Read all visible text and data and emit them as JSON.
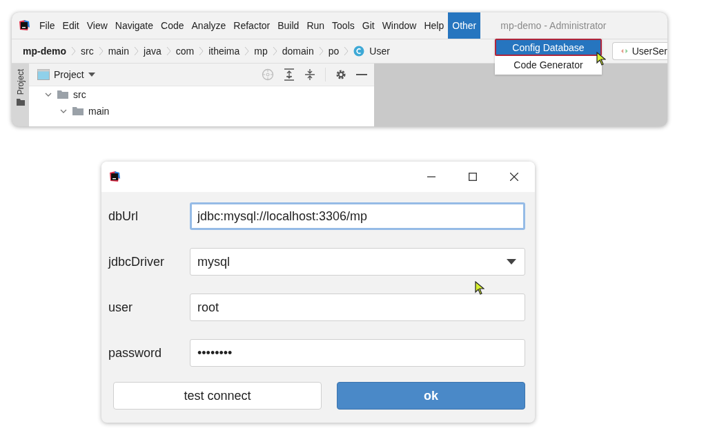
{
  "ide": {
    "menu": [
      {
        "label": "File",
        "selected": false
      },
      {
        "label": "Edit",
        "selected": false
      },
      {
        "label": "View",
        "selected": false
      },
      {
        "label": "Navigate",
        "selected": false
      },
      {
        "label": "Code",
        "selected": false
      },
      {
        "label": "Analyze",
        "selected": false
      },
      {
        "label": "Refactor",
        "selected": false
      },
      {
        "label": "Build",
        "selected": false
      },
      {
        "label": "Run",
        "selected": false
      },
      {
        "label": "Tools",
        "selected": false
      },
      {
        "label": "Git",
        "selected": false
      },
      {
        "label": "Window",
        "selected": false
      },
      {
        "label": "Help",
        "selected": false
      },
      {
        "label": "Other",
        "selected": true
      }
    ],
    "window_title": "mp-demo - Administrator",
    "breadcrumbs": [
      "mp-demo",
      "src",
      "main",
      "java",
      "com",
      "itheima",
      "mp",
      "domain",
      "po",
      "User"
    ],
    "editor_tab": "UserSer",
    "tool_window_stripe": "Project",
    "project_panel": {
      "title": "Project",
      "tree": [
        {
          "label": "src",
          "expanded": true,
          "children": [
            {
              "label": "main",
              "expanded": true
            }
          ]
        }
      ]
    },
    "dropdown": [
      {
        "label": "Config Database",
        "selected": true
      },
      {
        "label": "Code Generator",
        "selected": false
      }
    ]
  },
  "dialog": {
    "fields": [
      {
        "kind": "text",
        "label": "dbUrl",
        "value": "jdbc:mysql://localhost:3306/mp",
        "focused": true
      },
      {
        "kind": "select",
        "label": "jdbcDriver",
        "value": "mysql",
        "focused": false
      },
      {
        "kind": "text",
        "label": "user",
        "value": "root",
        "focused": false
      },
      {
        "kind": "password",
        "label": "password",
        "value": "••••••••",
        "focused": false
      }
    ],
    "buttons": [
      {
        "label": "test connect",
        "kind": "secondary"
      },
      {
        "label": "ok",
        "kind": "primary"
      }
    ]
  }
}
